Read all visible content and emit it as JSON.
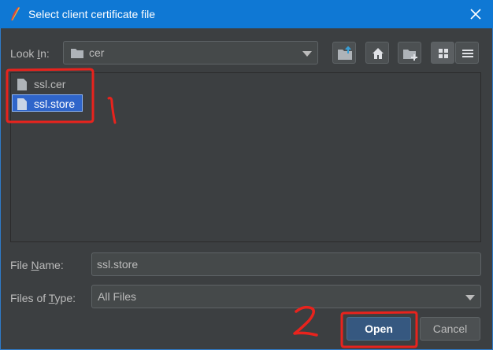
{
  "window": {
    "title": "Select client certificate file",
    "close_icon": "close-icon",
    "app_icon": "feather-app-icon"
  },
  "look_in": {
    "label_pre": "Look ",
    "label_mnemonic": "I",
    "label_post": "n:",
    "value": "cer",
    "folder_icon": "folder-icon"
  },
  "toolbar": {
    "buttons": [
      "up-folder-icon",
      "home-icon",
      "new-folder-icon",
      "list-view-icon",
      "details-view-icon"
    ]
  },
  "files": [
    {
      "name": "ssl.cer",
      "selected": false
    },
    {
      "name": "ssl.store",
      "selected": true
    }
  ],
  "file_name": {
    "label_pre": "File ",
    "label_mnemonic": "N",
    "label_post": "ame:",
    "value": "ssl.store"
  },
  "file_type": {
    "label_pre": "Files of ",
    "label_mnemonic": "T",
    "label_post": "ype:",
    "value": "All Files"
  },
  "buttons": {
    "open": "Open",
    "cancel": "Cancel"
  },
  "annotations": {
    "color": "#e8231d",
    "marks": [
      "1",
      "2"
    ]
  },
  "colors": {
    "titlebar": "#0f78d4",
    "background": "#3c3f41",
    "selection": "#2f65ca",
    "primary_button": "#365880"
  }
}
